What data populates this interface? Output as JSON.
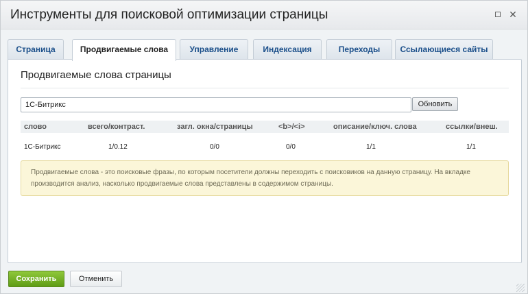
{
  "dialog": {
    "title": "Инструменты для поисковой оптимизации страницы"
  },
  "tabs": [
    {
      "label": "Страница"
    },
    {
      "label": "Продвигаемые слова"
    },
    {
      "label": "Управление"
    },
    {
      "label": "Индексация"
    },
    {
      "label": "Переходы"
    },
    {
      "label": "Ссылающиеся сайты"
    }
  ],
  "active_tab": "Продвигаемые слова",
  "panel": {
    "section_title": "Продвигаемые слова страницы",
    "keyword_input_value": "1С-Битрикс",
    "refresh_label": "Обновить",
    "columns": [
      "слово",
      "всего/контраст.",
      "загл. окна/страницы",
      "<b>/<i>",
      "описание/ключ. слова",
      "ссылки/внеш."
    ],
    "rows": [
      [
        "1С-Битрикс",
        "1/0.12",
        "0/0",
        "0/0",
        "1/1",
        "1/1"
      ]
    ],
    "note": "Продвигаемые слова - это поисковые фразы, по которым посетители должны переходить с поисковиков на данную страницу. На вкладке производится анализ, насколько продвигаемые слова представлены в содержимом страницы."
  },
  "footer": {
    "save_label": "Сохранить",
    "cancel_label": "Отменить"
  },
  "colors": {
    "accent_green": "#6aa61f",
    "tab_text": "#1b4f8a",
    "note_bg": "#fbf6d9"
  }
}
